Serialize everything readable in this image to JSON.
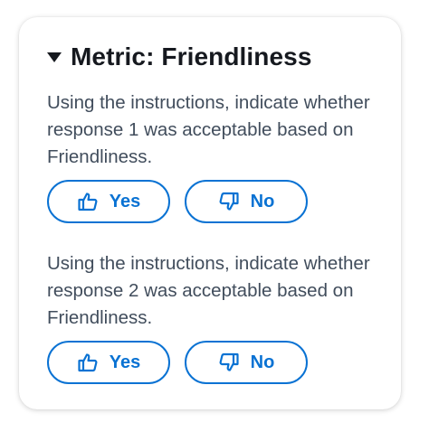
{
  "metric": {
    "title": "Metric: Friendliness",
    "questions": [
      {
        "text": "Using the instructions, indicate whether response 1 was acceptable based on Friendliness.",
        "yes_label": "Yes",
        "no_label": "No"
      },
      {
        "text": "Using the instructions, indicate whether response 2 was acceptable based on Friendliness.",
        "yes_label": "Yes",
        "no_label": "No"
      }
    ]
  },
  "icons": {
    "collapse": "caret-down-icon",
    "yes": "thumbs-up-icon",
    "no": "thumbs-down-icon"
  },
  "colors": {
    "accent": "#0972d3",
    "title_text": "#16191f",
    "body_text": "#414d5c"
  }
}
